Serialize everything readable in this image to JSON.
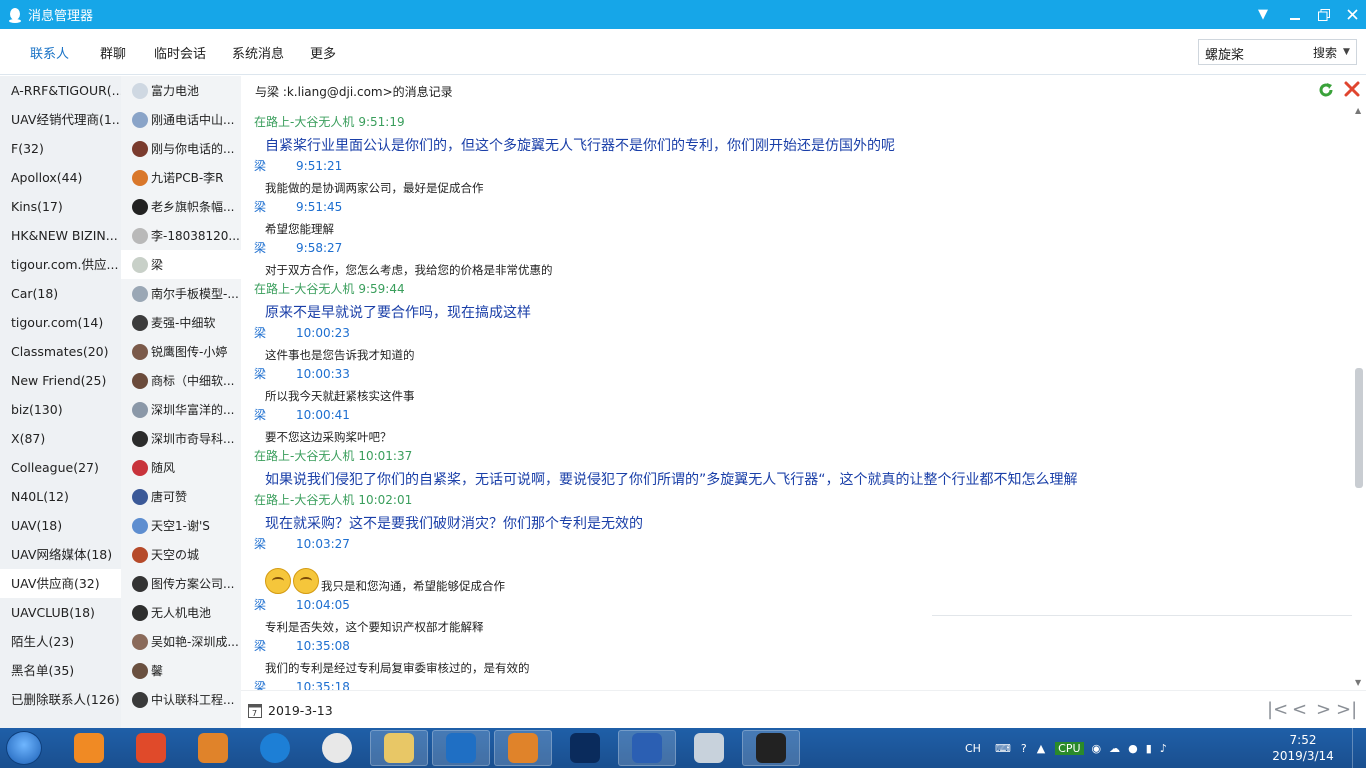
{
  "window": {
    "title": "消息管理器"
  },
  "tabs": [
    {
      "label": "联系人",
      "active": true
    },
    {
      "label": "群聊"
    },
    {
      "label": "临时会话"
    },
    {
      "label": "系统消息"
    },
    {
      "label": "更多"
    }
  ],
  "search": {
    "value": "螺旋桨",
    "button": "搜索"
  },
  "groups": [
    "A-RRF&TIGOUR(...",
    "UAV经销代理商(1...",
    "F(32)",
    "Apollox(44)",
    "Kins(17)",
    "HK&NEW BIZIN...",
    "tigour.com.供应...",
    "Car(18)",
    "tigour.com(14)",
    "Classmates(20)",
    "New Friend(25)",
    "biz(130)",
    "X(87)",
    "Colleague(27)",
    "N40L(12)",
    "UAV(18)",
    "UAV网络媒体(18)",
    "UAV供应商(32)",
    "UAVCLUB(18)",
    "陌生人(23)",
    "黑名单(35)",
    "已删除联系人(126)"
  ],
  "selected_group_index": 17,
  "contacts": [
    {
      "name": "富力电池",
      "color": "#cfd8e2"
    },
    {
      "name": "刚通电话中山...",
      "color": "#8aa4c8"
    },
    {
      "name": "刚与你电话的...",
      "color": "#7a3b2e"
    },
    {
      "name": "九诺PCB-李R",
      "color": "#d9772a"
    },
    {
      "name": "老乡旗帜条幅...",
      "color": "#222222"
    },
    {
      "name": "李-18038120...",
      "color": "#b9b9b9"
    },
    {
      "name": "梁",
      "color": "#c8d0c8"
    },
    {
      "name": "南尔手板模型-...",
      "color": "#9aa7b5"
    },
    {
      "name": "麦强-中细软",
      "color": "#3c3c3c"
    },
    {
      "name": "锐鹰图传-小婷",
      "color": "#7b5a4a"
    },
    {
      "name": "商标（中细软...",
      "color": "#6b4b3b"
    },
    {
      "name": "深圳华富洋的...",
      "color": "#8b98a8"
    },
    {
      "name": "深圳市奇导科...",
      "color": "#2b2b2b"
    },
    {
      "name": "随风",
      "color": "#c8333b"
    },
    {
      "name": "唐可赞",
      "color": "#3b5998"
    },
    {
      "name": "天空1-谢'S",
      "color": "#5e8ed0"
    },
    {
      "name": "天空の城",
      "color": "#b64a2a"
    },
    {
      "name": "图传方案公司...",
      "color": "#333333"
    },
    {
      "name": "无人机电池",
      "color": "#2e2e2e"
    },
    {
      "name": "吴如艳-深圳成...",
      "color": "#8a6a5a"
    },
    {
      "name": "馨",
      "color": "#6a5040"
    },
    {
      "name": "中认联科工程...",
      "color": "#3a3a3a"
    }
  ],
  "selected_contact_index": 6,
  "record": {
    "title": "与梁        :k.liang@dji.com>的消息记录"
  },
  "messages": [
    {
      "who": "me",
      "sender": "在路上-大谷无人机",
      "time": "9:51:19",
      "text": "自紧桨行业里面公认是你们的，但这个多旋翼无人飞行器不是你们的专利，你们刚开始还是仿国外的呢",
      "style": "big"
    },
    {
      "who": "them",
      "sender": "梁",
      "time": "9:51:21",
      "text": "我能做的是协调两家公司，最好是促成合作",
      "style": "small"
    },
    {
      "who": "them",
      "sender": "梁",
      "time": "9:51:45",
      "text": "希望您能理解",
      "style": "small"
    },
    {
      "who": "them",
      "sender": "梁",
      "time": "9:58:27",
      "text": "对于双方合作，您怎么考虑，我给您的价格是非常优惠的",
      "style": "small"
    },
    {
      "who": "me",
      "sender": "在路上-大谷无人机",
      "time": "9:59:44",
      "text": "原来不是早就说了要合作吗，现在搞成这样",
      "style": "big"
    },
    {
      "who": "them",
      "sender": "梁",
      "time": "10:00:23",
      "text": "这件事也是您告诉我才知道的",
      "style": "small"
    },
    {
      "who": "them",
      "sender": "梁",
      "time": "10:00:33",
      "text": "所以我今天就赶紧核实这件事",
      "style": "small"
    },
    {
      "who": "them",
      "sender": "梁",
      "time": "10:00:41",
      "text": "要不您这边采购桨叶吧？",
      "style": "small"
    },
    {
      "who": "me",
      "sender": "在路上-大谷无人机",
      "time": "10:01:37",
      "text": "如果说我们侵犯了你们的自紧桨，无话可说啊，要说侵犯了你们所谓的”多旋翼无人飞行器“，这个就真的让整个行业都不知怎么理解",
      "style": "big"
    },
    {
      "who": "me",
      "sender": "在路上-大谷无人机",
      "time": "10:02:01",
      "text": "现在就采购？这不是要我们破财消灾？你们那个专利是无效的",
      "style": "big"
    },
    {
      "who": "them",
      "sender": "梁",
      "time": "10:03:27",
      "text": "我只是和您沟通，希望能够促成合作",
      "style": "emoji",
      "emoji_count": 2
    },
    {
      "who": "them",
      "sender": "梁",
      "time": "10:04:05",
      "text": "专利是否失效，这个要知识产权部才能解释",
      "style": "small"
    },
    {
      "who": "them",
      "sender": "梁",
      "time": "10:35:08",
      "text": "我们的专利是经过专利局复审委审核过的，是有效的",
      "style": "small"
    },
    {
      "who": "them",
      "sender": "梁",
      "time": "10:35:18",
      "text": "",
      "style": "small"
    }
  ],
  "footer": {
    "date": "2019-3-13"
  },
  "taskbar": {
    "time": "7:52",
    "date": "2019/3/14",
    "lang": "CH",
    "apps": [
      "uc-browser-icon",
      "monkey-icon",
      "monkey2-icon",
      "sogou-icon",
      "chrome-icon",
      "explorer-icon",
      "outlook-icon",
      "monkey3-icon",
      "photoshop-icon",
      "word-icon",
      "paint-icon",
      "qq-icon"
    ]
  },
  "colors": {
    "titlebar": "#16a6e8",
    "my_name": "#3a9e5c",
    "their_name": "#1e6fd0",
    "accent": "#1a73c6"
  }
}
